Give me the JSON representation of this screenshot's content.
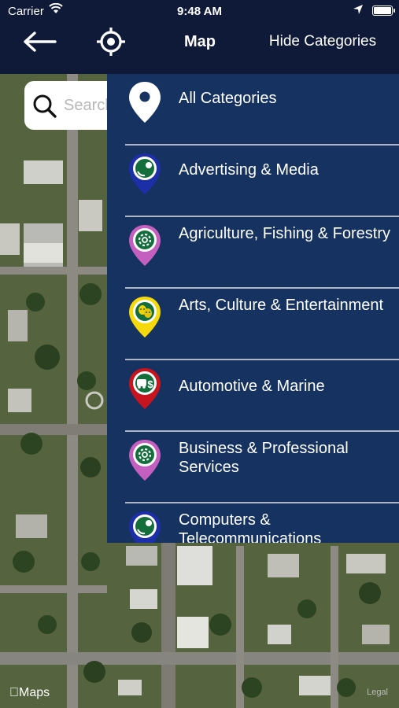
{
  "status_bar": {
    "carrier": "Carrier",
    "time": "9:48 AM"
  },
  "nav": {
    "title": "Map",
    "hide_button": "Hide Categories"
  },
  "search": {
    "placeholder": "Search"
  },
  "map": {
    "brand": "Maps",
    "legal": "Legal"
  },
  "categories": [
    {
      "label": "All Categories",
      "icon": "location-pin-icon",
      "color": "#ffffff"
    },
    {
      "label": "Advertising & Media",
      "icon": "megaphone-icon",
      "color": "#1c2fa8"
    },
    {
      "label": "Agriculture, Fishing & Forestry",
      "icon": "gear-icon",
      "color": "#c45fc0"
    },
    {
      "label": "Arts, Culture & Entertainment",
      "icon": "theater-masks-icon",
      "color": "#f5d90a"
    },
    {
      "label": "Automotive & Marine",
      "icon": "car-icon",
      "color": "#c8141e"
    },
    {
      "label": "Business & Professional Services",
      "icon": "gear-icon",
      "color": "#c45fc0"
    },
    {
      "label": "Computers & Telecommunications",
      "icon": "megaphone-icon",
      "color": "#1c2fa8"
    }
  ]
}
